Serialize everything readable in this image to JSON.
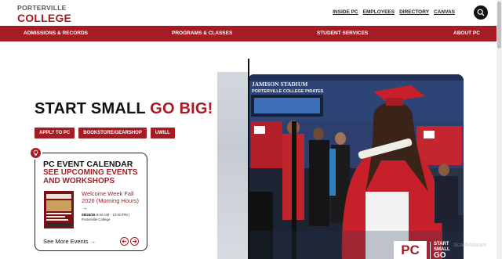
{
  "header": {
    "logo_line1": "PORTERVILLE",
    "logo_line2": "COLLEGE",
    "quick_links": [
      "INSIDE PC",
      "EMPLOYEES",
      "DIRECTORY",
      "CANVAS"
    ],
    "search_icon": "search-icon"
  },
  "nav": {
    "items": [
      "ADMISSIONS & RECORDS",
      "PROGRAMS & CLASSES",
      "STUDENT SERVICES",
      "ABOUT PC"
    ]
  },
  "hero": {
    "headline_black": "START SMALL",
    "headline_red": "GO BIG!",
    "buttons": [
      "APPLY TO PC",
      "BOOKSTORE/GEARSHOP",
      "UWILL"
    ]
  },
  "events": {
    "icon": "lightbulb-icon",
    "title": "PC EVENT CALENDAR",
    "subtitle": "SEE UPCOMING EVENTS AND WORKSHOPS",
    "event_title": "Welcome Week Fall 2026 (Morning Hours)",
    "event_arrow": "→",
    "event_date": "08/25/26",
    "event_time": "9:00 AM - 12:00 PM |",
    "event_location": "Porterville College",
    "see_more": "See More Events",
    "see_more_arrow": "→",
    "prev_icon": "arrow-left-icon",
    "next_icon": "arrow-right-icon"
  },
  "photo": {
    "stadium_line1": "JAMISON STADIUM",
    "stadium_line2": "PORTERVILLE COLLEGE PIRATES",
    "logo_pc": "PC",
    "logo_tag1": "START",
    "logo_tag2": "SMALL",
    "logo_tag3": "GO"
  },
  "watermark": "ScanMalware",
  "colors": {
    "brand_red": "#a51c24",
    "text_dark": "#111111"
  }
}
